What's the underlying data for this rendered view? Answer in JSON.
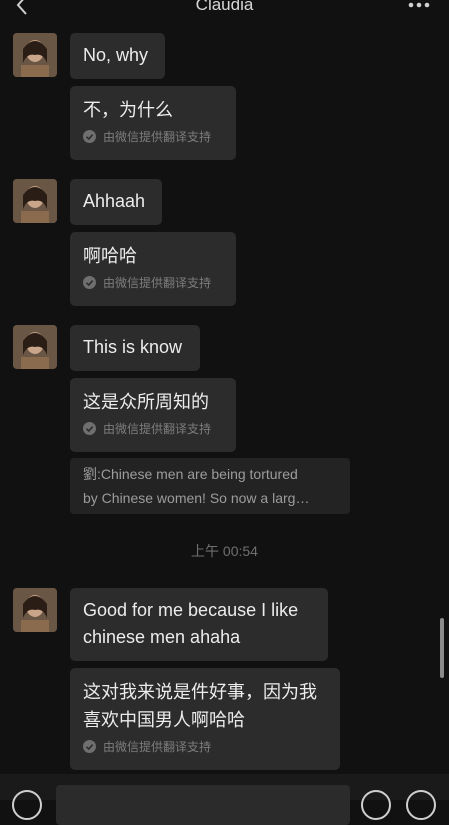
{
  "header": {
    "title": "Claudia",
    "back_icon": "chevron-left-icon",
    "more_icon": "ellipsis-icon"
  },
  "messages": [
    {
      "original": "No, why",
      "translation": "不，为什么",
      "credit": "由微信提供翻译支持"
    },
    {
      "original": "Ahhaah",
      "translation": "啊哈哈",
      "credit": "由微信提供翻译支持"
    },
    {
      "original": "This is know",
      "translation": "这是众所周知的",
      "credit": "由微信提供翻译支持"
    },
    {
      "original_line1": "Good for me because I like",
      "original_line2": "chinese men ahaha",
      "translation_line1": "这对我来说是件好事，因为我",
      "translation_line2": "喜欢中国男人啊哈哈",
      "credit": "由微信提供翻译支持"
    }
  ],
  "quote": {
    "line1": "劉:Chinese men are being tortured",
    "line2": "by Chinese women! So now a larg…"
  },
  "timestamp": "上午 00:54",
  "colors": {
    "background": "#111111",
    "bubble": "#2c2c2c",
    "quote_bg": "#232323",
    "credit_text": "#7d7d7d"
  }
}
